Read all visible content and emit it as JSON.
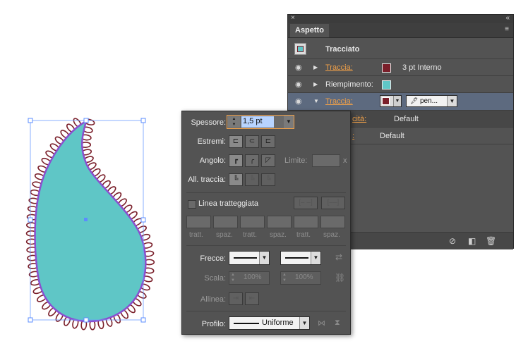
{
  "appearance_panel": {
    "close_glyph": "×",
    "collapse_glyph": "«",
    "tab_label": "Aspetto",
    "menu_glyph": "≡",
    "object_label": "Tracciato",
    "rows": [
      {
        "label": "Traccia:",
        "value": "3 pt  Interno",
        "swatch": "#7a1f2a"
      },
      {
        "label": "Riempimento:",
        "swatch": "#5fc6c6"
      },
      {
        "label": "Traccia:",
        "brush_name": "pen...",
        "swatch": "#7a1f2a"
      },
      {
        "label": "cità:",
        "value": "Default"
      },
      {
        "label": ":",
        "value": "Default"
      }
    ]
  },
  "stroke_panel": {
    "weight_label": "Spessore:",
    "weight_value": "1,5 pt",
    "caps_label": "Estremi:",
    "corner_label": "Angolo:",
    "limit_label": "Limite:",
    "limit_multiplier": "x",
    "align_label": "All. traccia:",
    "dashed_label": "Linea tratteggiata",
    "dash_labels": [
      "tratt.",
      "spaz.",
      "tratt.",
      "spaz.",
      "tratt.",
      "spaz."
    ],
    "arrows_label": "Frecce:",
    "scale_label": "Scala:",
    "scale_start": "100%",
    "scale_end": "100%",
    "align_arrows_label": "Allinea:",
    "profile_label": "Profilo:",
    "profile_value": "Uniforme"
  },
  "colors": {
    "fill": "#5fc6c6",
    "stroke": "#7a1f2a",
    "path_outline": "#8a4fd0",
    "selection": "#5b8cff"
  }
}
